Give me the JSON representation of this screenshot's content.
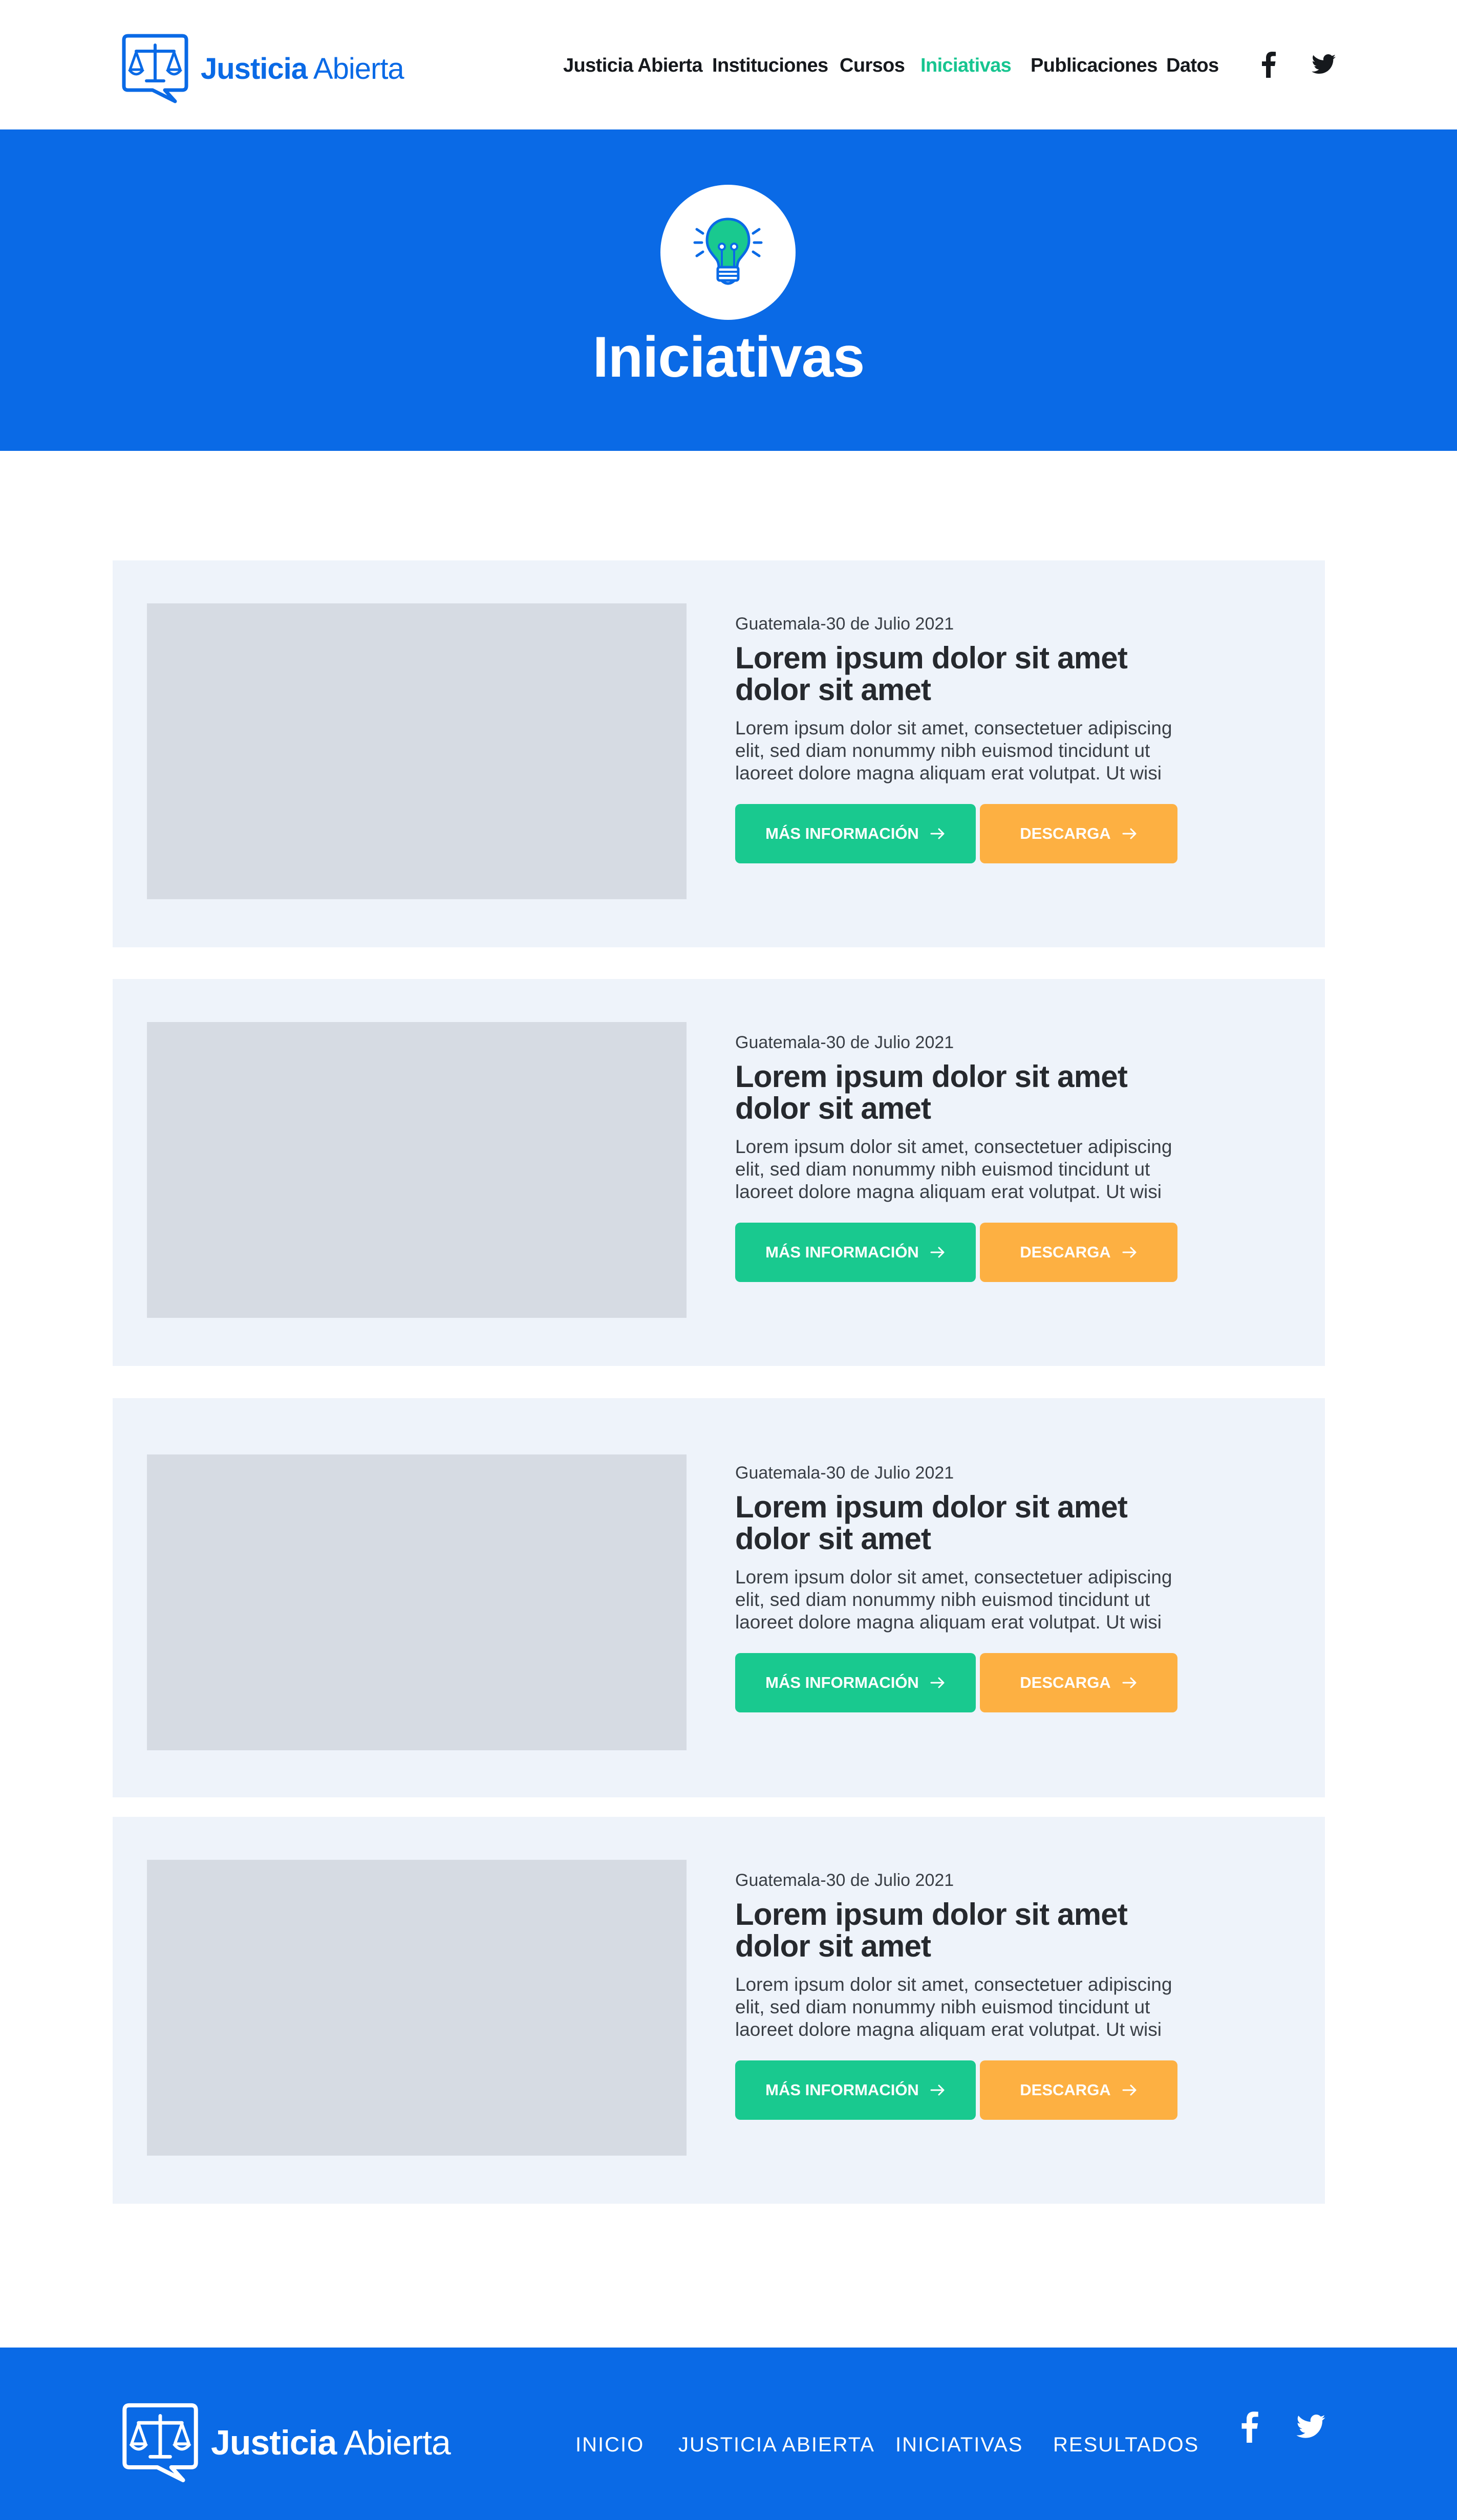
{
  "header": {
    "logo": {
      "bold": "Justicia",
      "light": "Abierta"
    },
    "nav": [
      {
        "label": "Justicia Abierta",
        "active": false
      },
      {
        "label": "Instituciones",
        "active": false
      },
      {
        "label": "Cursos",
        "active": false
      },
      {
        "label": "Iniciativas",
        "active": true
      },
      {
        "label": "Publicaciones",
        "active": false
      },
      {
        "label": "Datos",
        "active": false
      }
    ],
    "social": [
      "facebook-icon",
      "twitter-icon"
    ]
  },
  "hero": {
    "icon": "lightbulb-icon",
    "title": "Iniciativas"
  },
  "cards": [
    {
      "date": "Guatemala-30 de Julio 2021",
      "title": "Lorem ipsum dolor sit amet dolor sit amet",
      "description": "Lorem ipsum dolor sit amet, consectetuer adipiscing elit, sed diam nonummy nibh euismod tincidunt ut laoreet dolore magna aliquam erat volutpat. Ut wisi",
      "more_label": "MÁS INFORMACIÓN",
      "download_label": "DESCARGA"
    },
    {
      "date": "Guatemala-30 de Julio 2021",
      "title": "Lorem ipsum dolor sit amet dolor sit amet",
      "description": "Lorem ipsum dolor sit amet, consectetuer adipiscing elit, sed diam nonummy nibh euismod tincidunt ut laoreet dolore magna aliquam erat volutpat. Ut wisi",
      "more_label": "MÁS INFORMACIÓN",
      "download_label": "DESCARGA"
    },
    {
      "date": "Guatemala-30 de Julio 2021",
      "title": "Lorem ipsum dolor sit amet dolor sit amet",
      "description": "Lorem ipsum dolor sit amet, consectetuer adipiscing elit, sed diam nonummy nibh euismod tincidunt ut laoreet dolore magna aliquam erat volutpat. Ut wisi",
      "more_label": "MÁS INFORMACIÓN",
      "download_label": "DESCARGA"
    },
    {
      "date": "Guatemala-30 de Julio 2021",
      "title": "Lorem ipsum dolor sit amet dolor sit amet",
      "description": "Lorem ipsum dolor sit amet, consectetuer adipiscing elit, sed diam nonummy nibh euismod tincidunt ut laoreet dolore magna aliquam erat volutpat. Ut wisi",
      "more_label": "MÁS INFORMACIÓN",
      "download_label": "DESCARGA"
    }
  ],
  "footer": {
    "logo": {
      "bold": "Justicia",
      "light": "Abierta"
    },
    "links": [
      "INICIO",
      "JUSTICIA ABIERTA",
      "INICIATIVAS",
      "RESULTADOS"
    ],
    "social": [
      "facebook-icon",
      "twitter-icon"
    ]
  },
  "colors": {
    "brand_blue": "#0a6ae6",
    "accent_green": "#19c98f",
    "accent_orange": "#fdb042",
    "card_background": "#eef3fa",
    "image_placeholder": "#d6dbe3"
  }
}
